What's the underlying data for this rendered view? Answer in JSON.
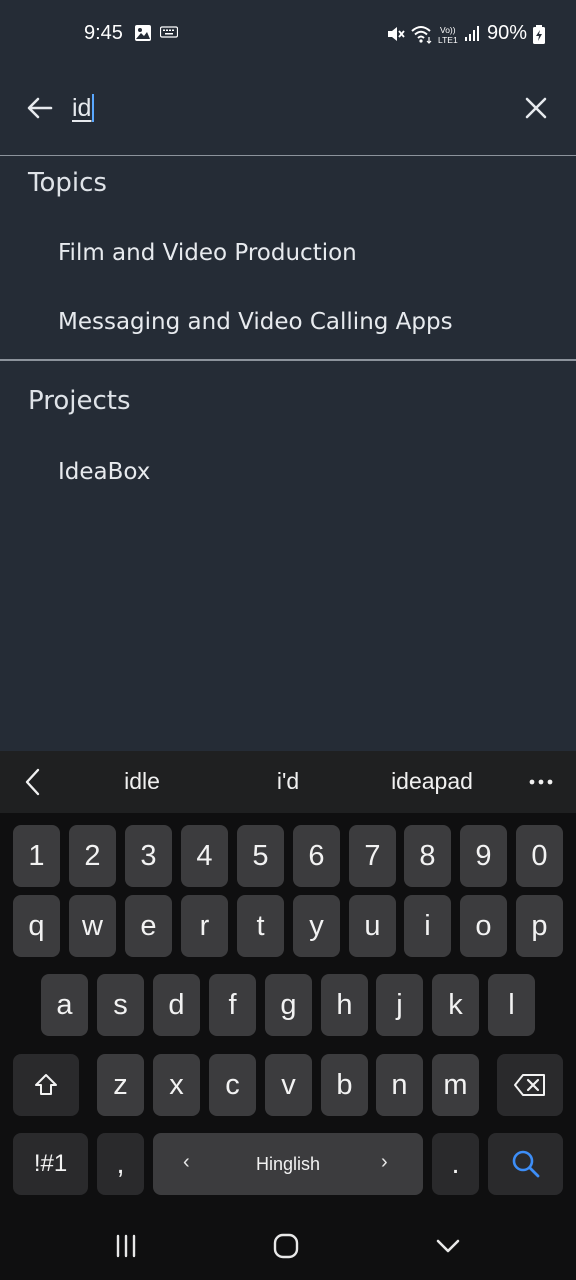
{
  "status_bar": {
    "time": "9:45",
    "battery": "90%",
    "icons": [
      "image-icon",
      "keyboard-icon",
      "mute-icon",
      "wifi-icon",
      "volte-icon",
      "signal-icon",
      "battery-charging-icon"
    ]
  },
  "search": {
    "value": "id",
    "back_icon": "arrow-left-icon",
    "clear_icon": "close-icon"
  },
  "sections": {
    "topics": {
      "title": "Topics",
      "items": [
        "Film and Video Production",
        "Messaging and Video Calling Apps"
      ]
    },
    "projects": {
      "title": "Projects",
      "items": [
        "IdeaBox"
      ]
    }
  },
  "keyboard": {
    "suggestions": [
      "idle",
      "i'd",
      "ideapad"
    ],
    "row_numbers": [
      "1",
      "2",
      "3",
      "4",
      "5",
      "6",
      "7",
      "8",
      "9",
      "0"
    ],
    "row_top": [
      "q",
      "w",
      "e",
      "r",
      "t",
      "y",
      "u",
      "i",
      "o",
      "p"
    ],
    "row_middle": [
      "a",
      "s",
      "d",
      "f",
      "g",
      "h",
      "j",
      "k",
      "l"
    ],
    "row_bottom": [
      "z",
      "x",
      "c",
      "v",
      "b",
      "n",
      "m"
    ],
    "symbols_label": "!#1",
    "comma_label": ",",
    "space_label": "Hinglish",
    "period_label": ".",
    "accent_color": "#3d8ef8"
  },
  "nav": {
    "icons": [
      "recents-icon",
      "home-icon",
      "hide-keyboard-icon"
    ]
  }
}
